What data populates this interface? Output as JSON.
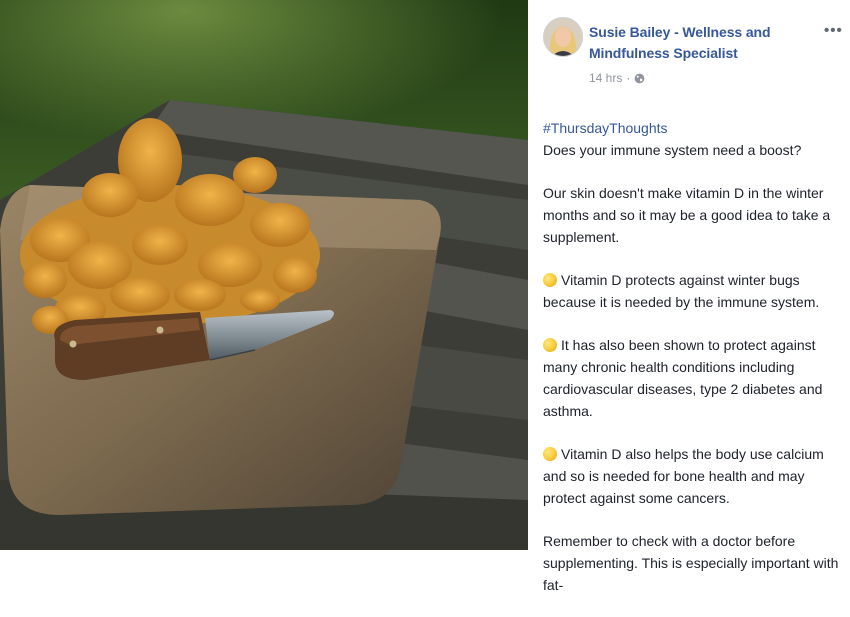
{
  "post": {
    "author_name": "Susie Bailey - Wellness and Mindfulness Specialist",
    "timestamp": "14 hrs",
    "privacy_icon": "globe-icon",
    "more_icon": "more-options-icon",
    "hashtag": "#ThursdayThoughts",
    "paragraphs": [
      "Does your immune system need a boost?",
      "Our skin doesn't make vitamin D in the winter months and so it may be a good idea to take a supplement.",
      "Vitamin D protects against winter bugs because it is needed by the immune system.",
      "It has also been shown to protect against many chronic health conditions including cardiovascular diseases, type 2 diabetes and asthma.",
      "Vitamin D also helps the body use calcium and so is needed for bone health and may protect against some cancers.",
      "Remember to check with a doctor before supplementing. This is especially important with fat-"
    ]
  },
  "colors": {
    "link": "#365899",
    "text": "#1d2129",
    "meta": "#90949c"
  },
  "photo": {
    "subject": "chanterelle mushrooms and knife on wooden board"
  }
}
